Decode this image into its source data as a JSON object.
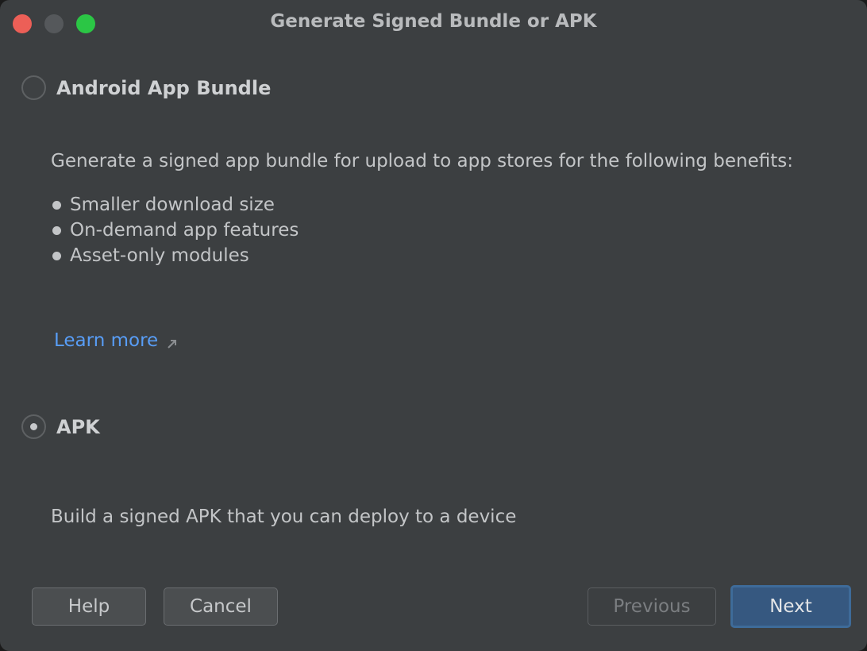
{
  "window": {
    "title": "Generate Signed Bundle or APK"
  },
  "options": {
    "bundle": {
      "label": "Android App Bundle",
      "selected": false,
      "description": "Generate a signed app bundle for upload to app stores for the following benefits:",
      "benefits": [
        "Smaller download size",
        "On-demand app features",
        "Asset-only modules"
      ],
      "learn_more": "Learn more"
    },
    "apk": {
      "label": "APK",
      "selected": true,
      "description": "Build a signed APK that you can deploy to a device"
    }
  },
  "buttons": {
    "help": "Help",
    "cancel": "Cancel",
    "previous": "Previous",
    "next": "Next"
  },
  "icons": {
    "learn_more": "external-link-arrow-icon"
  },
  "colors": {
    "background": "#3c3f41",
    "link": "#589df6",
    "primary_button": "#365880",
    "close": "#ec5f57",
    "maximize": "#2bc645"
  }
}
